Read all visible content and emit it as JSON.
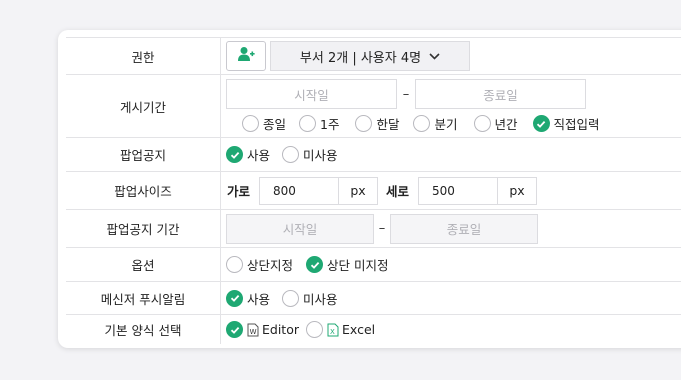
{
  "rows": {
    "permission": {
      "label": "권한",
      "dept_button": "부서 2개 | 사용자 4명"
    },
    "post_period": {
      "label": "게시기간",
      "start_placeholder": "시작일",
      "end_placeholder": "종료일",
      "separator": "–",
      "options": [
        "종일",
        "1주",
        "한달",
        "분기",
        "년간",
        "직접입력"
      ],
      "selected": "직접입력"
    },
    "popup_notice": {
      "label": "팝업공지",
      "options": [
        "사용",
        "미사용"
      ],
      "selected": "사용"
    },
    "popup_size": {
      "label": "팝업사이즈",
      "width_label": "가로",
      "width_value": "800",
      "height_label": "세로",
      "height_value": "500",
      "unit": "px"
    },
    "popup_period": {
      "label": "팝업공지 기간",
      "start_placeholder": "시작일",
      "end_placeholder": "종료일",
      "separator": "–"
    },
    "option": {
      "label": "옵션",
      "options": [
        "상단지정",
        "상단 미지정"
      ],
      "selected": "상단 미지정"
    },
    "messenger_push": {
      "label": "메신저 푸시알림",
      "options": [
        "사용",
        "미사용"
      ],
      "selected": "사용"
    },
    "default_format": {
      "label": "기본 양식 선택",
      "options": [
        "Editor",
        "Excel"
      ],
      "selected": "Editor"
    }
  },
  "colors": {
    "accent": "#1fa873",
    "border": "#e3e3e6",
    "placeholder": "#b0b0b6"
  },
  "icons": {
    "add_user": "add-user-icon",
    "chevron": "chevron-down-icon",
    "editor": "word-doc-icon",
    "excel": "excel-doc-icon"
  }
}
